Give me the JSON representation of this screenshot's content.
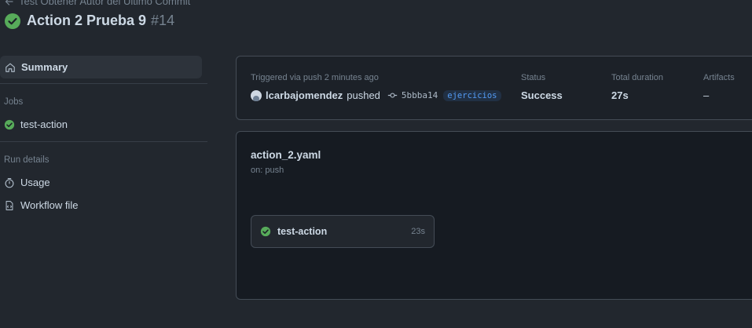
{
  "header": {
    "back_label": "Test Obtener Autor del Último Commit",
    "title": "Action 2 Prueba 9",
    "run_number": "#14"
  },
  "sidebar": {
    "summary_label": "Summary",
    "jobs_title": "Jobs",
    "jobs": [
      {
        "label": "test-action"
      }
    ],
    "run_details_title": "Run details",
    "usage_label": "Usage",
    "workflow_file_label": "Workflow file"
  },
  "meta": {
    "triggered_label": "Triggered via push 2 minutes ago",
    "user": "lcarbajomendez",
    "action": "pushed",
    "commit": "5bbba14",
    "branch": "ejercicios",
    "status_label": "Status",
    "status_value": "Success",
    "duration_label": "Total duration",
    "duration_value": "27s",
    "artifacts_label": "Artifacts",
    "artifacts_value": "–"
  },
  "workflow": {
    "file_name": "action_2.yaml",
    "trigger": "on: push",
    "job": {
      "label": "test-action",
      "duration": "23s"
    }
  },
  "colors": {
    "success": "#57ab5a",
    "background": "#22272e",
    "card": "#1c2128",
    "accent": "#539bf5"
  }
}
